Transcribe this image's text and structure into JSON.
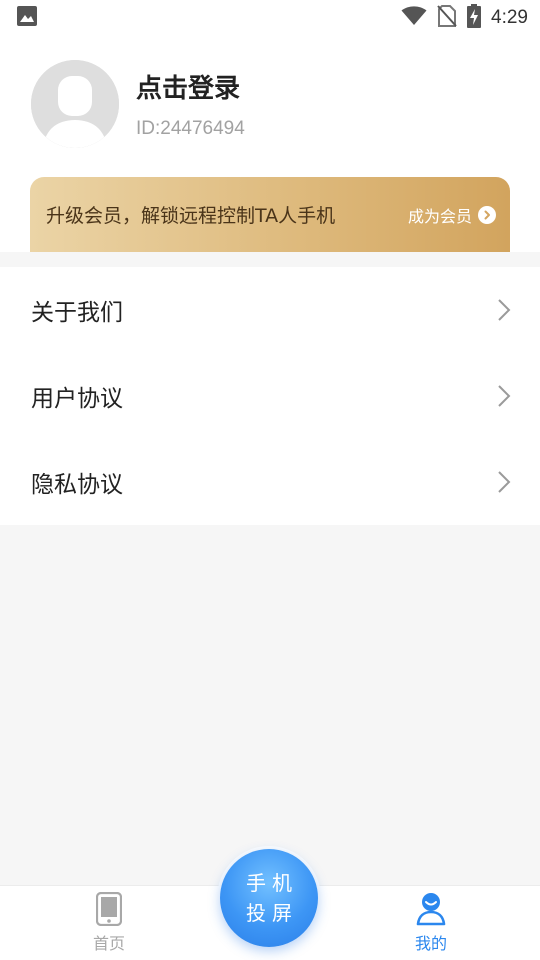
{
  "status_bar": {
    "time": "4:29",
    "icons": [
      "image-icon",
      "wifi-icon",
      "no-sim-icon",
      "battery-charging-icon"
    ]
  },
  "profile": {
    "login_label": "点击登录",
    "user_id": "ID:24476494"
  },
  "vip_banner": {
    "text": "升级会员，解锁远程控制TA人手机",
    "action_label": "成为会员"
  },
  "menu": {
    "items": [
      {
        "label": "关于我们"
      },
      {
        "label": "用户协议"
      },
      {
        "label": "隐私协议"
      }
    ]
  },
  "tab_bar": {
    "home_label": "首页",
    "cast_line1": "手机",
    "cast_line2": "投屏",
    "mine_label": "我的",
    "active_tab": "mine"
  },
  "colors": {
    "accent": "#2b87ee",
    "vip_gold": "#deba7d",
    "background": "#f6f6f6"
  }
}
